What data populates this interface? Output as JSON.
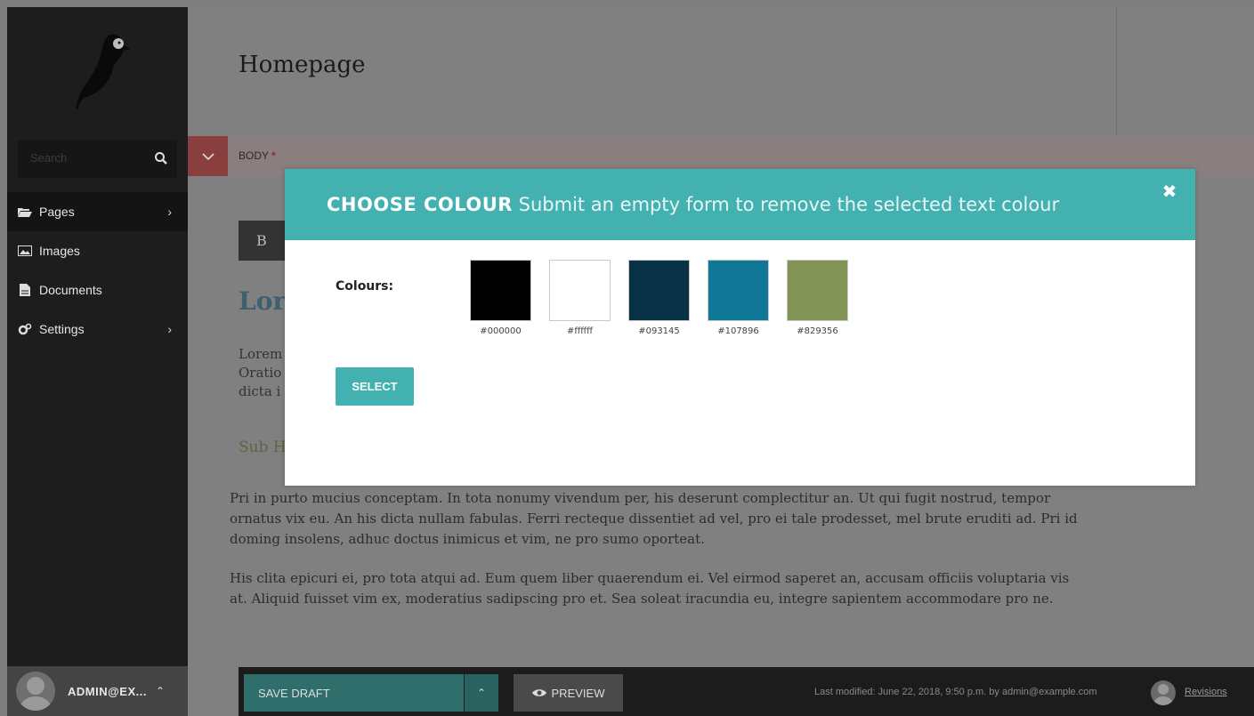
{
  "sidebar": {
    "search_placeholder": "Search",
    "items": [
      {
        "label": "Pages",
        "icon": "folder-open-icon",
        "has_submenu": true,
        "active": true
      },
      {
        "label": "Images",
        "icon": "image-icon",
        "has_submenu": false
      },
      {
        "label": "Documents",
        "icon": "document-icon",
        "has_submenu": false
      },
      {
        "label": "Settings",
        "icon": "cogs-icon",
        "has_submenu": true
      }
    ],
    "account_name": "ADMIN@EX..."
  },
  "page": {
    "title": "Homepage",
    "field_label": "BODY",
    "required_marker": "*",
    "bold_button": "B",
    "heading_fragment": "Lor",
    "p1_fragments": [
      "Lorem",
      "Oratio",
      "dicta i"
    ],
    "subheading_fragment": "Sub H",
    "paragraph_2": "Pri in purto mucius conceptam. In tota nonumy vivendum per, his deserunt complectitur an. Ut qui fugit nostrud, tempor ornatus vix eu. An his dicta nullam fabulas. Ferri recteque dissentiet ad vel, pro ei tale prodesset, mel brute eruditi ad. Pri id doming insolens, adhuc doctus inimicus et vim, ne pro sumo oporteat.",
    "paragraph_3": "His clita epicuri ei, pro tota atqui ad. Eum quem liber quaerendum ei. Vel eirmod saperet an, accusam officiis voluptaria vis at. Aliquid fuisset vim ex, moderatius sadipscing pro et. Sea soleat iracundia eu, integre sapientem accommodare pro ne."
  },
  "footer": {
    "save_label": "SAVE DRAFT",
    "preview_label": "PREVIEW",
    "last_modified": "Last modified: June 22, 2018, 9:50 p.m. by admin@example.com",
    "revisions_label": "Revisions"
  },
  "modal": {
    "title_strong": "CHOOSE COLOUR",
    "title_sub": "Submit an empty form to remove the selected text colour",
    "close_symbol": "✖",
    "colours_label": "Colours:",
    "swatches": [
      {
        "code": "#000000",
        "color": "#000000"
      },
      {
        "code": "#ffffff",
        "color": "#ffffff"
      },
      {
        "code": "#093145",
        "color": "#093145"
      },
      {
        "code": "#107896",
        "color": "#107896"
      },
      {
        "code": "#829356",
        "color": "#829356"
      }
    ],
    "select_label": "SELECT"
  },
  "colors": {
    "accent": "#43b1b0",
    "sidebar_bg": "#1d1d1d",
    "overlay": "#7f7f7f"
  }
}
